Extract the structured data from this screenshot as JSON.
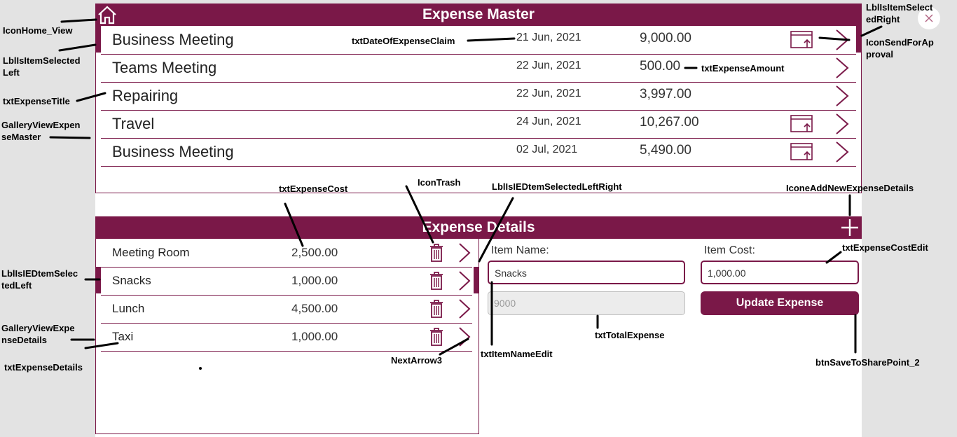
{
  "master": {
    "title": "Expense Master",
    "rows": [
      {
        "title": "Business Meeting",
        "date": "21 Jun, 2021",
        "amount": "9,000.00",
        "send": true
      },
      {
        "title": "Teams Meeting",
        "date": "22 Jun, 2021",
        "amount": "500.00",
        "send": false
      },
      {
        "title": "Repairing",
        "date": "22 Jun, 2021",
        "amount": "3,997.00",
        "send": false
      },
      {
        "title": "Travel",
        "date": "24 Jun, 2021",
        "amount": "10,267.00",
        "send": true
      },
      {
        "title": "Business Meeting",
        "date": "02 Jul, 2021",
        "amount": "5,490.00",
        "send": true
      }
    ]
  },
  "details": {
    "title": "Expense Details",
    "rows": [
      {
        "title": "Meeting Room",
        "cost": "2,500.00"
      },
      {
        "title": "Snacks",
        "cost": "1,000.00"
      },
      {
        "title": "Lunch",
        "cost": "4,500.00"
      },
      {
        "title": "Taxi",
        "cost": "1,000.00"
      }
    ]
  },
  "form": {
    "item_name_label": "Item Name:",
    "item_name_value": "Snacks",
    "item_cost_label": "Item Cost:",
    "item_cost_value": "1,000.00",
    "total_value": "9000",
    "update_button": "Update Expense"
  },
  "annotations": {
    "icon_home": "IconHome_View",
    "lbl_selected_left": "LblIsItemSelected Left",
    "txt_expense_title": "txtExpenseTitle",
    "gallery_master": "GalleryViewExpen seMaster",
    "txt_date": "txtDateOfExpenseClaim",
    "txt_amount": "txtExpenseAmount",
    "lbl_selected_right": "LblIsItemSelect edRight",
    "icon_send": "IconSendForAp proval",
    "txt_expense_cost": "txtExpenseCost",
    "icon_trash": "IconTrash",
    "lbl_ed_leftright": "LblIsIEDtemSelectedLeftRight",
    "icon_add": "IconeAddNewExpenseDetails",
    "txt_cost_edit": "txtExpenseCostEdit",
    "lbl_ed_left": "LblIsIEDtemSelec tedLeft",
    "gallery_details": "GalleryViewExpe nseDetails",
    "txt_details": "txtExpenseDetails",
    "next_arrow": "NextArrow3",
    "txt_item_name_edit": "txtItemNameEdit",
    "txt_total": "txtTotalExpense",
    "btn_save": "btnSaveToSharePoint_2"
  },
  "colors": {
    "accent": "#7a1848",
    "background": "#e3e3e3"
  }
}
